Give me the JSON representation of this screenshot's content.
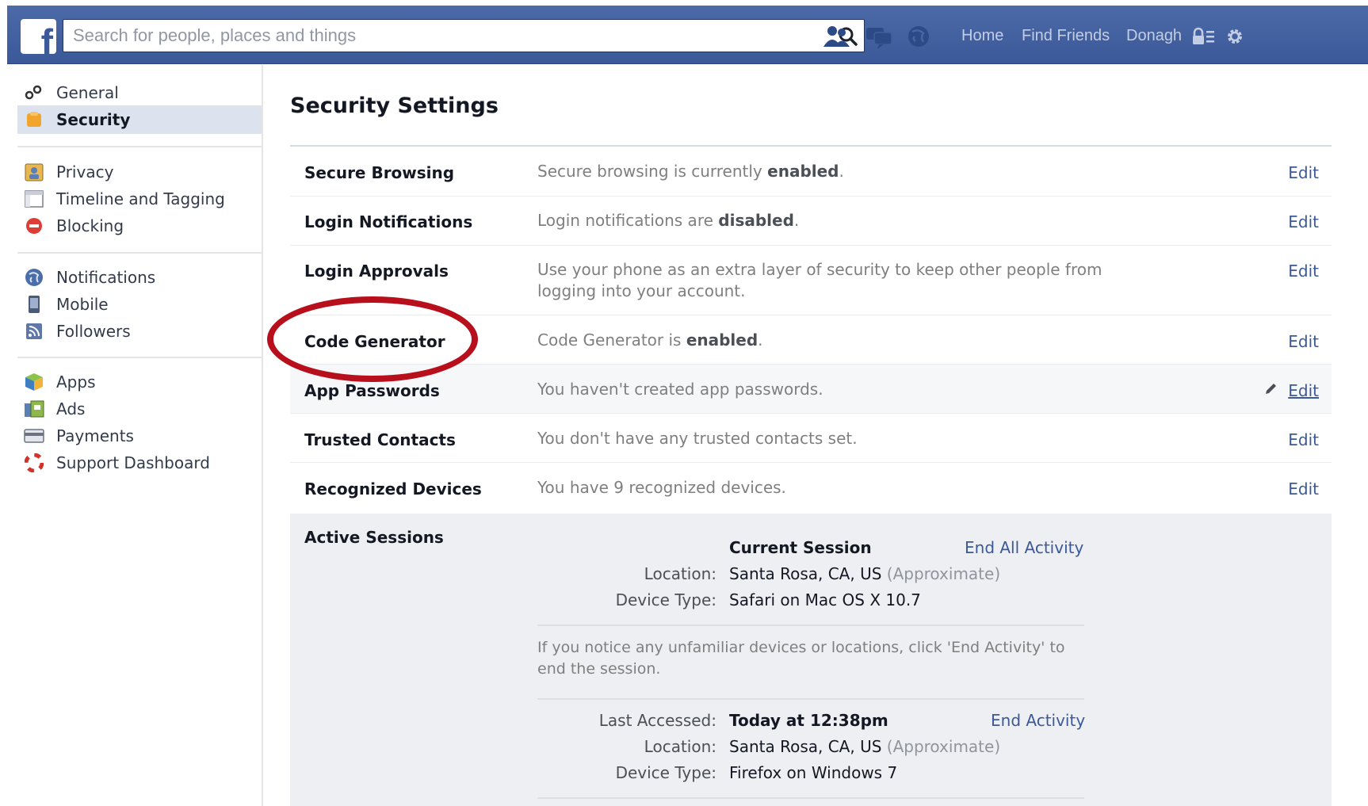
{
  "topbar": {
    "logo_letter": "f",
    "search_placeholder": "Search for people, places and things",
    "nav": {
      "home": "Home",
      "find_friends": "Find Friends",
      "profile": "Donagh"
    }
  },
  "sidebar": {
    "groups": [
      [
        {
          "label": "General",
          "icon": "gears-icon"
        },
        {
          "label": "Security",
          "icon": "security-badge-icon",
          "selected": true
        }
      ],
      [
        {
          "label": "Privacy",
          "icon": "privacy-lock-icon"
        },
        {
          "label": "Timeline and Tagging",
          "icon": "timeline-icon"
        },
        {
          "label": "Blocking",
          "icon": "blocking-icon"
        }
      ],
      [
        {
          "label": "Notifications",
          "icon": "globe-icon"
        },
        {
          "label": "Mobile",
          "icon": "mobile-phone-icon"
        },
        {
          "label": "Followers",
          "icon": "rss-icon"
        }
      ],
      [
        {
          "label": "Apps",
          "icon": "apps-cube-icon"
        },
        {
          "label": "Ads",
          "icon": "ads-icon"
        },
        {
          "label": "Payments",
          "icon": "credit-card-icon"
        },
        {
          "label": "Support Dashboard",
          "icon": "lifebuoy-icon"
        }
      ]
    ]
  },
  "main": {
    "title": "Security Settings",
    "rows": [
      {
        "name": "Secure Browsing",
        "desc_pre": "Secure browsing is currently ",
        "desc_bold": "enabled",
        "desc_post": ".",
        "edit": "Edit"
      },
      {
        "name": "Login Notifications",
        "desc_pre": "Login notifications are ",
        "desc_bold": "disabled",
        "desc_post": ".",
        "edit": "Edit"
      },
      {
        "name": "Login Approvals",
        "desc_pre": "Use your phone as an extra layer of security to keep other people from logging into your account.",
        "desc_bold": "",
        "desc_post": "",
        "edit": "Edit"
      },
      {
        "name": "Code Generator",
        "desc_pre": "Code Generator is ",
        "desc_bold": "enabled",
        "desc_post": ".",
        "edit": "Edit"
      },
      {
        "name": "App Passwords",
        "desc_pre": "You haven't created app passwords.",
        "desc_bold": "",
        "desc_post": "",
        "edit": "Edit"
      },
      {
        "name": "Trusted Contacts",
        "desc_pre": "You don't have any trusted contacts set.",
        "desc_bold": "",
        "desc_post": "",
        "edit": "Edit"
      },
      {
        "name": "Recognized Devices",
        "desc_pre": "You have 9 recognized devices.",
        "desc_bold": "",
        "desc_post": "",
        "edit": "Edit"
      }
    ],
    "active_sessions": {
      "name": "Active Sessions",
      "current": {
        "heading": "Current Session",
        "end_all": "End All Activity",
        "location_label": "Location:",
        "location": "Santa Rosa, CA, US",
        "approx": "(Approximate)",
        "device_label": "Device Type:",
        "device": "Safari on Mac OS X 10.7"
      },
      "notice": "If you notice any unfamiliar devices or locations, click 'End Activity' to end the session.",
      "other": {
        "accessed_label": "Last Accessed:",
        "accessed": "Today at 12:38pm",
        "end": "End Activity",
        "location_label": "Location:",
        "location": "Santa Rosa, CA, US",
        "approx": "(Approximate)",
        "device_label": "Device Type:",
        "device": "Firefox on Windows 7"
      }
    }
  },
  "colors": {
    "brand": "#3b5998",
    "annotation": "#b70f1b",
    "selected_bg": "#dce2ee"
  }
}
